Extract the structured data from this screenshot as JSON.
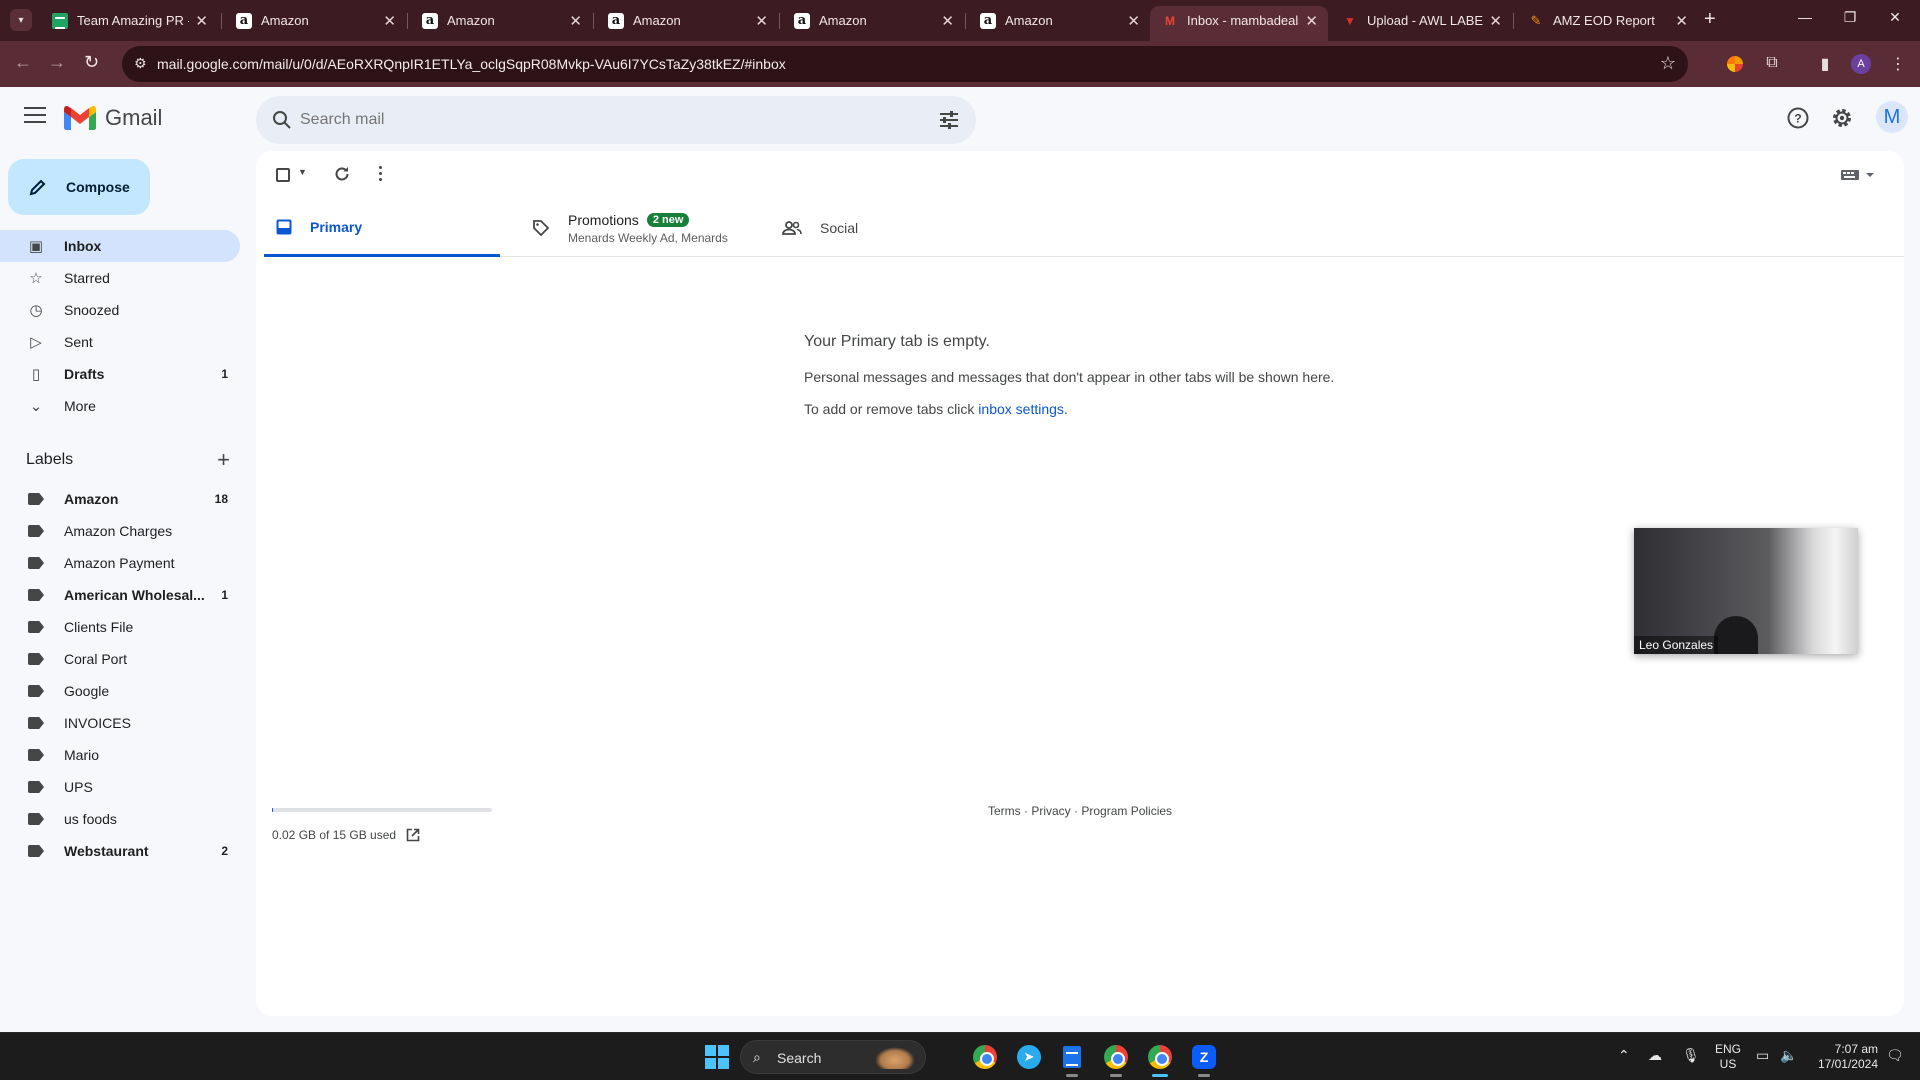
{
  "browser": {
    "tabs": [
      {
        "title": "Team Amazing PR - G",
        "favicon": "sheets-icon"
      },
      {
        "title": "Amazon",
        "favicon": "amazon-icon"
      },
      {
        "title": "Amazon",
        "favicon": "amazon-icon"
      },
      {
        "title": "Amazon",
        "favicon": "amazon-icon"
      },
      {
        "title": "Amazon",
        "favicon": "amazon-icon"
      },
      {
        "title": "Amazon",
        "favicon": "amazon-icon"
      },
      {
        "title": "Inbox - mambadeals",
        "favicon": "gmail-icon",
        "active": true
      },
      {
        "title": "Upload - AWL LABEL",
        "favicon": "awl-icon"
      },
      {
        "title": "AMZ EOD Report",
        "favicon": "amz-report-icon"
      }
    ],
    "url": "mail.google.com/mail/u/0/d/AEoRXRQnpIR1ETLYa_oclgSqpR08Mvkp-VAu6I7YCsTaZy38tkEZ/#inbox",
    "profile_initial": "A",
    "theme_color": "#5a2d36"
  },
  "gmail": {
    "product_name": "Gmail",
    "search": {
      "placeholder": "Search mail"
    },
    "avatar_initial": "M",
    "compose_label": "Compose",
    "nav": [
      {
        "label": "Inbox",
        "icon": "inbox-icon",
        "count": "",
        "active": true
      },
      {
        "label": "Starred",
        "icon": "star-icon",
        "count": ""
      },
      {
        "label": "Snoozed",
        "icon": "clock-icon",
        "count": ""
      },
      {
        "label": "Sent",
        "icon": "send-icon",
        "count": ""
      },
      {
        "label": "Drafts",
        "icon": "draft-icon",
        "count": "1",
        "bold": true
      },
      {
        "label": "More",
        "icon": "chevron-down-icon",
        "count": ""
      }
    ],
    "labels_heading": "Labels",
    "labels": [
      {
        "label": "Amazon",
        "count": "18",
        "bold": true
      },
      {
        "label": "Amazon Charges",
        "count": ""
      },
      {
        "label": "Amazon Payment",
        "count": ""
      },
      {
        "label": "American Wholesal...",
        "count": "1",
        "bold": true
      },
      {
        "label": "Clients File",
        "count": ""
      },
      {
        "label": "Coral Port",
        "count": ""
      },
      {
        "label": "Google",
        "count": ""
      },
      {
        "label": "INVOICES",
        "count": ""
      },
      {
        "label": "Mario",
        "count": ""
      },
      {
        "label": "UPS",
        "count": ""
      },
      {
        "label": "us foods",
        "count": ""
      },
      {
        "label": "Webstaurant",
        "count": "2",
        "bold": true
      }
    ],
    "tabs": {
      "primary": "Primary",
      "promotions": {
        "label": "Promotions",
        "badge": "2 new",
        "subtitle": "Menards Weekly Ad, Menards"
      },
      "social": "Social"
    },
    "empty_state": {
      "title": "Your Primary tab is empty.",
      "line1": "Personal messages and messages that don't appear in other tabs will be shown here.",
      "line2_prefix": "To add or remove tabs click ",
      "line2_link": "inbox settings",
      "line2_suffix": "."
    },
    "storage": {
      "text": "0.02 GB of 15 GB used",
      "used_fraction": 0.0013
    },
    "footer": {
      "terms": "Terms",
      "sep": " · ",
      "privacy": "Privacy",
      "policies": "Program Policies"
    }
  },
  "video_overlay": {
    "participant_name": "Leo Gonzales"
  },
  "taskbar": {
    "search_label": "Search",
    "language": "ENG",
    "region": "US",
    "time": "7:07 am",
    "date": "17/01/2024"
  }
}
